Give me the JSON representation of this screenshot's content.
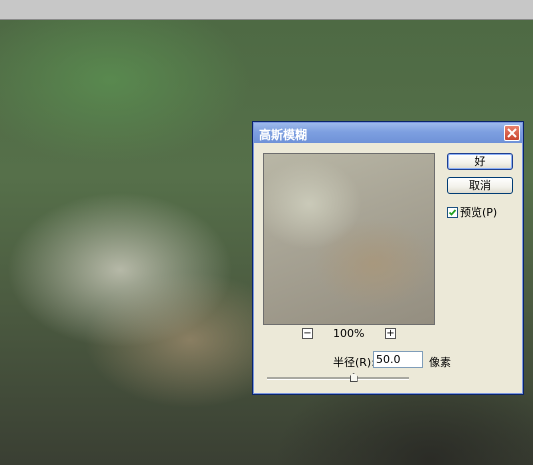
{
  "dialog": {
    "title": "高斯模糊",
    "ok_label": "好",
    "cancel_label": "取消",
    "preview_checkbox": {
      "label": "预览(P)",
      "checked": true
    },
    "zoom": {
      "level": "100%",
      "minus": "−",
      "plus": "+"
    },
    "radius": {
      "label": "半径(R):",
      "value": "50.0",
      "unit": "像素",
      "slider_fraction": 0.61
    }
  },
  "colors": {
    "title_bar": "#7d9fe0",
    "dialog_bg": "#ece9d8",
    "close_button": "#c9452f"
  },
  "icons": {
    "close": "close-icon",
    "check": "check-icon"
  }
}
